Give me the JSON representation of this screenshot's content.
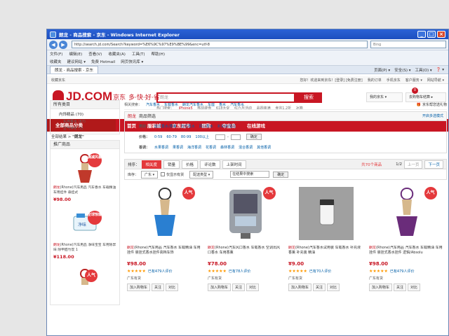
{
  "window": {
    "title": "朗龙 - 商品搜索 - 京东 - Windows Internet Explorer",
    "minimize": "_",
    "maximize": "□",
    "close": "×"
  },
  "addressbar": {
    "url": "http://search.jd.com/Search?keyword=%E6%9C%97%E9%BE%99&enc=utf-8",
    "search_placeholder": "Bing"
  },
  "menubar": [
    "文件(F)",
    "编辑(E)",
    "查看(V)",
    "收藏夹(A)",
    "工具(T)",
    "帮助(H)"
  ],
  "favbar": [
    "收藏夹",
    "建议网站 ▾",
    "免费 Hotmail",
    "网页快讯库 ▾"
  ],
  "tabbar": {
    "tab": "朗龙 - 商品搜索 - 京东",
    "tools": [
      "页面(P) ▾",
      "安全(S) ▾",
      "工具(O) ▾",
      "❓ ▾"
    ]
  },
  "topbar": {
    "left": "收藏京东",
    "links": [
      "您好！欢迎来到京东！[登录] [免费注册]",
      "我的订单",
      "手机京东",
      "客户服务 ▾",
      "网站导航 ▾"
    ]
  },
  "header": {
    "logo": "JD.COM",
    "logo_cn": "京东",
    "slogan": "多·快·好·省",
    "search_value": "朗龙",
    "search_button": "搜索",
    "hot_label": "热门搜索：",
    "hot_words": [
      "iPhone5",
      "移动硬盘",
      "618大促",
      "红六月活动",
      "晶圆装满",
      "食完1.2折",
      "冰箱"
    ],
    "my_jd": "我的京东 ▾",
    "cart": "去购物车结算 ▸",
    "cart_count": "0"
  },
  "nav": {
    "all_categories": "全部商品分类",
    "items": [
      "首页",
      "服装城",
      "京东超市",
      "团购",
      "夺宝岛",
      "在线游戏"
    ]
  },
  "breadcrumb": {
    "prefix": "全部结果 > ",
    "keyword": "\"朗龙\""
  },
  "left": {
    "category_title": "所有类目",
    "cat_main": "内饰精品 (70)",
    "cat_subs": [
      "车用香水 (67)",
      "空气净化 (3)"
    ],
    "promo_title": "推广商品",
    "promos": [
      {
        "brand": "朗龙",
        "name": "(Rhone)汽车用品 汽车香水 车载精油 车用挂件 悬挂式",
        "price": "¥98.00",
        "badge": "满减风暴"
      },
      {
        "brand": "朗龙",
        "name": "(Rhone)汽车用品 净味宝宝 车用除异味 除甲醛竹炭 1",
        "price": "¥118.00",
        "badge": "全球惊爆"
      },
      {
        "brand": "",
        "name": "",
        "price": "",
        "badge": "人气"
      }
    ]
  },
  "main": {
    "related_label": "相关搜索：",
    "related": [
      "汽车香水",
      "车载香水",
      "朗龙汽车香水",
      "车座",
      "香水",
      "汽车香水"
    ],
    "gift_text": "京东帮您选礼物",
    "filter_keyword": "朗龙",
    "filter_title": "商品筛选",
    "filter_more": "开启多选模式",
    "rows": [
      {
        "label": "类别：",
        "items": [
          "座式香水/香薰",
          "挂式香水",
          "风口香水",
          "补充液/固芯"
        ]
      },
      {
        "label": "价格：",
        "items": [
          "0-59",
          "60-79",
          "80-99",
          "100以上"
        ],
        "ok": "确定"
      },
      {
        "label": "香调：",
        "items": [
          "水果香调",
          "果香调",
          "海洋香调",
          "花香调",
          "森林香调",
          "混合香调",
          "其他香调"
        ]
      }
    ],
    "sort_label": "排序：",
    "sort_buttons": [
      "相关度",
      "销量",
      "价格",
      "评论数",
      "上架时间"
    ],
    "result_count": "共70个商品",
    "page": "1/2",
    "prev_page": "上一页",
    "next_page": "下一页",
    "stock_label": "库存：",
    "region": "广东 ▾",
    "in_stock_only": "仅显示有货",
    "ship_type": "配送类型 ▾",
    "in_search": "在结果中搜索",
    "confirm": "确定"
  },
  "products": [
    {
      "brand": "朗龙",
      "name": "(Rhone)汽车用品 汽车香水 车载精油 车用挂件 悬挂式香水挂件高档车饰",
      "price": "¥98.00",
      "stars": "★★★★★",
      "reviews": "已有479人评价",
      "stock": "广东有货",
      "badge": "人气",
      "img_color": "#2a7fd1"
    },
    {
      "brand": "朗龙",
      "name": "(Rhone)汽车风口香水 车载香水 空调出风口香水 车用香薰",
      "price": "¥78.00",
      "stars": "★★★★★",
      "reviews": "已有78人评价",
      "stock": "广东有货",
      "badge": "人气",
      "img_color": "#7c8088"
    },
    {
      "brand": "朗龙",
      "name": "(Rhone)汽车香水试用装 车载香水 补充液 香薰 补充装 精油",
      "price": "¥9.00",
      "stars": "★★★★★",
      "reviews": "已有70人评价",
      "stock": "广东有货",
      "badge": "",
      "img_color": "#d9d9d9"
    },
    {
      "brand": "朗龙",
      "name": "(Rhone)汽车用品 汽车香水 车载精油 车用挂件 悬挂式香水挂件 逻辑/Absolu",
      "price": "¥98.00",
      "stars": "★★★★★",
      "reviews": "已有479人评价",
      "stock": "广东有货",
      "badge": "人气",
      "img_color": "#6a2c7a"
    }
  ],
  "card_actions": [
    "加入购物车",
    "关注",
    "对比"
  ]
}
